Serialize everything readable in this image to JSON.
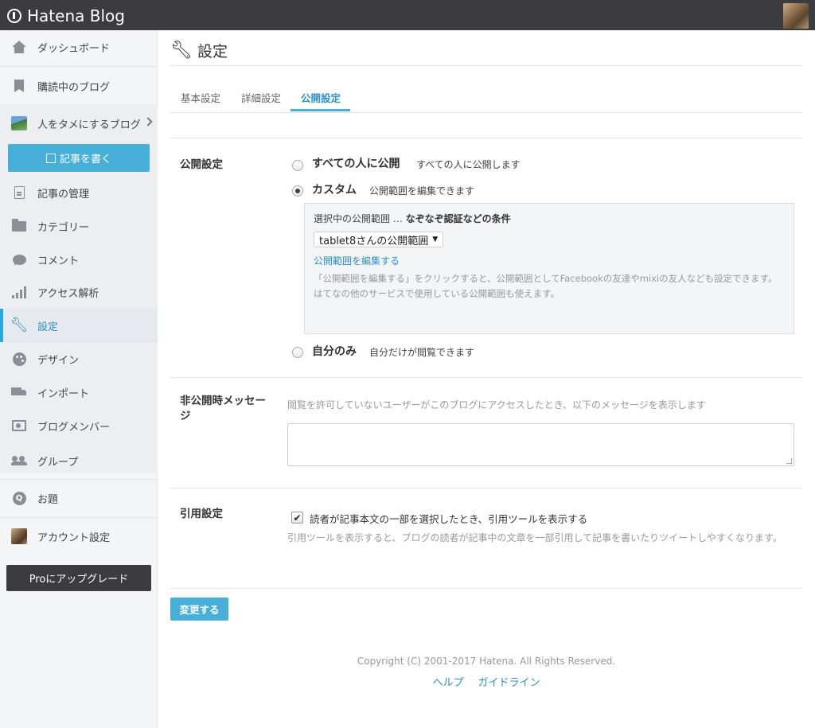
{
  "app": {
    "logo_text": "Hatena Blog"
  },
  "sidebar": {
    "items": [
      {
        "label": "ダッシュボード",
        "icon": "home-icon"
      },
      {
        "label": "購読中のブログ",
        "icon": "bookmark-icon"
      },
      {
        "label": "人をタメにするブログ",
        "icon": "blog-thumbnail-icon"
      },
      {
        "label": "記事の管理",
        "icon": "document-icon"
      },
      {
        "label": "カテゴリー",
        "icon": "folder-icon"
      },
      {
        "label": "コメント",
        "icon": "comment-icon"
      },
      {
        "label": "アクセス解析",
        "icon": "bar-chart-icon"
      },
      {
        "label": "設定",
        "icon": "wrench-icon"
      },
      {
        "label": "デザイン",
        "icon": "palette-icon"
      },
      {
        "label": "インポート",
        "icon": "truck-icon"
      },
      {
        "label": "ブログメンバー",
        "icon": "members-icon"
      },
      {
        "label": "グループ",
        "icon": "group-icon"
      },
      {
        "label": "お題",
        "icon": "q-icon"
      },
      {
        "label": "アカウント設定",
        "icon": "account-icon"
      }
    ],
    "write_button": "記事を書く",
    "pro_button": "Proにアップグレード",
    "accent": "#48b0d8"
  },
  "main": {
    "title": "設定",
    "tabs": [
      {
        "label": "基本設定"
      },
      {
        "label": "詳細設定"
      },
      {
        "label": "公開設定"
      }
    ],
    "publish": {
      "label": "公開設定",
      "options": [
        {
          "title": "すべての人に公開",
          "desc": "すべての人に公開します",
          "selected": false
        },
        {
          "title": "カスタム",
          "desc": "公開範囲を編集できます",
          "selected": true
        },
        {
          "title": "自分のみ",
          "desc": "自分だけが閲覧できます",
          "selected": false
        }
      ],
      "custom": {
        "prefix": "選択中の公開範囲 …",
        "condition": "なぞなぞ認証などの条件",
        "select_value": "tablet8さんの公開範囲",
        "edit_link": "公開範囲を編集する",
        "note1": "「公開範囲を編集する」をクリックすると、公開範囲としてFacebookの友達やmixiの友人なども設定できます。",
        "note2": "はてなの他のサービスで使用している公開範囲も使えます。"
      }
    },
    "private_message": {
      "label": "非公開時メッセージ",
      "hint": "閲覧を許可していないユーザーがこのブログにアクセスしたとき、以下のメッセージを表示します",
      "value": ""
    },
    "quote": {
      "label": "引用設定",
      "checkbox_label": "読者が記事本文の一部を選択したとき、引用ツールを表示する",
      "checked": true,
      "hint": "引用ツールを表示すると、ブログの読者が記事中の文章を一部引用して記事を書いたりツイートしやすくなります。"
    },
    "submit_label": "変更する"
  },
  "footer": {
    "copyright": "Copyright (C) 2001-2017 Hatena. All Rights Reserved.",
    "links": [
      "ヘルプ",
      "ガイドライン"
    ]
  }
}
